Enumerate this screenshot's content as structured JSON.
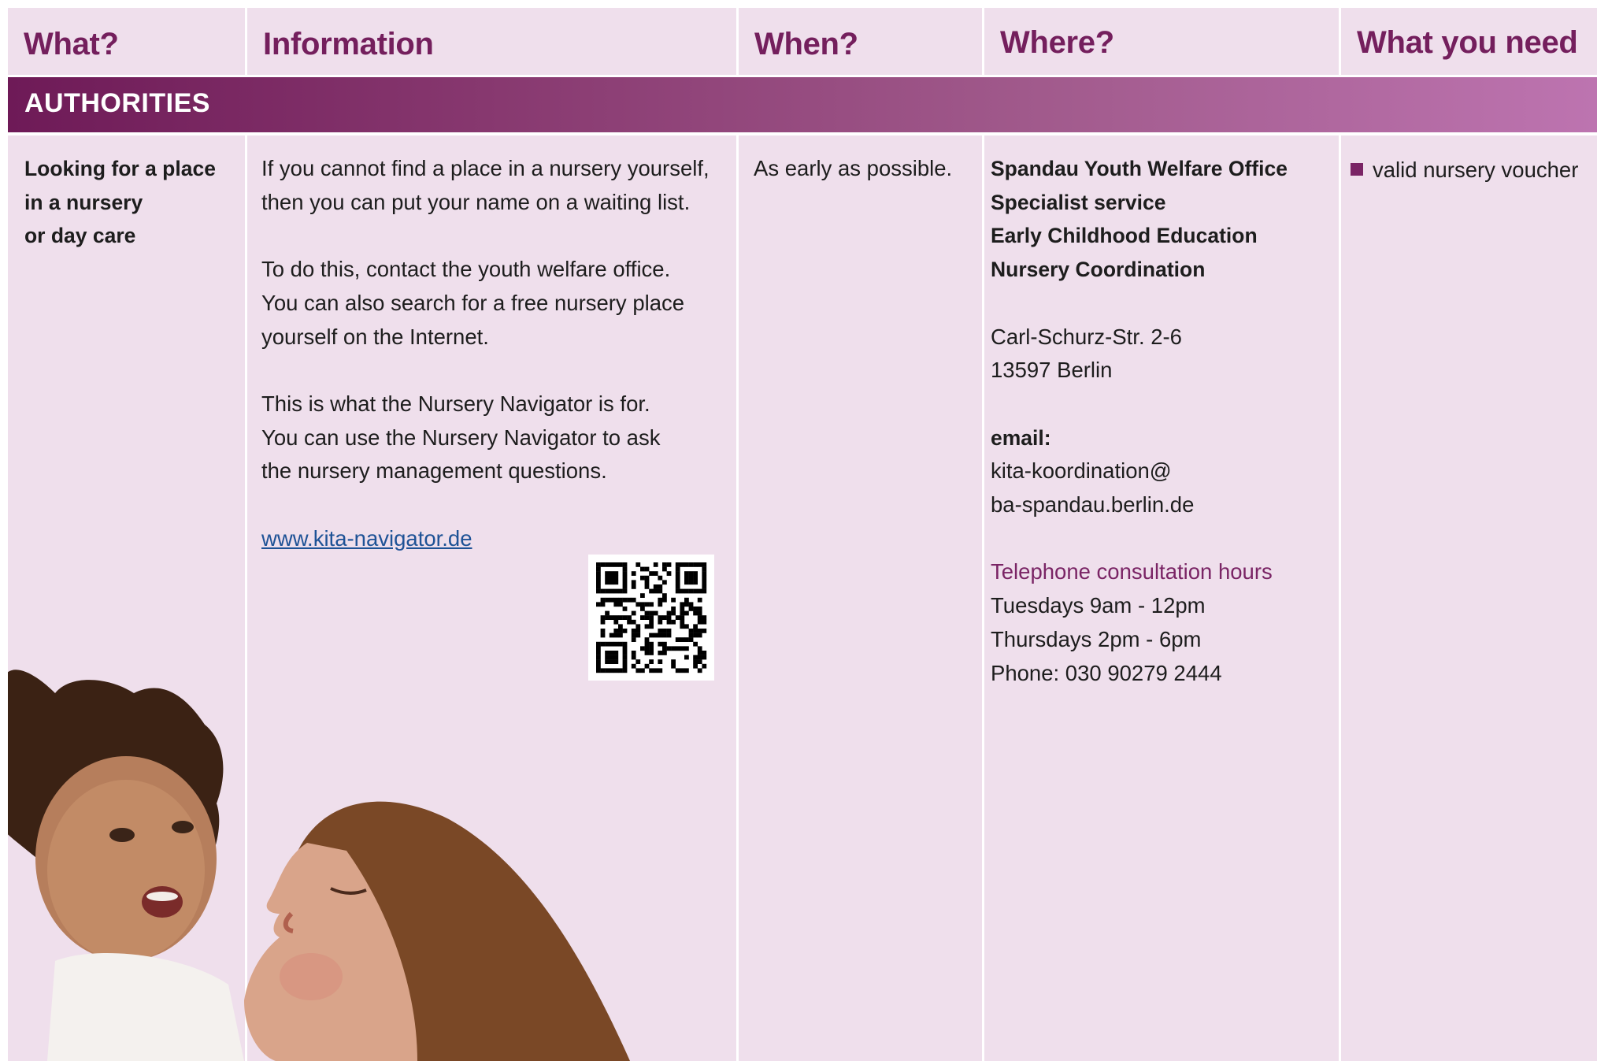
{
  "headers": {
    "what": "What?",
    "information": "Information",
    "when": "When?",
    "where": "Where?",
    "need": "What you need"
  },
  "section": "AUTHORITIES",
  "row": {
    "what": [
      "Looking for a place",
      "in a nursery",
      "or day care"
    ],
    "info_p1": [
      "If you cannot find a place in a nursery yourself,",
      "then you can put your name on a waiting list."
    ],
    "info_p2": [
      "To do this, contact the youth welfare office.",
      "You can also search for a free nursery place",
      "yourself on the Internet."
    ],
    "info_p3": [
      "This is what the Nursery Navigator is for.",
      "You can use the Nursery Navigator to ask",
      "the nursery management questions."
    ],
    "link": "www.kita-navigator.de",
    "when": "As early as possible.",
    "where_heading": [
      "Spandau Youth Welfare Office",
      "Specialist service",
      "Early Childhood Education",
      "Nursery Coordination"
    ],
    "address": [
      "Carl-Schurz-Str. 2-6",
      "13597 Berlin"
    ],
    "email_label": "email:",
    "email": [
      "kita-koordination@",
      "ba-spandau.berlin.de"
    ],
    "hours_label": "Telephone consultation hours",
    "hours": [
      "Tuesdays 9am - 12pm",
      "Thursdays 2pm - 6pm",
      "Phone: 030 90279 2444"
    ],
    "need": "valid nursery voucher"
  },
  "colors": {
    "heading": "#741f5d",
    "cell_bg": "#efdfec",
    "band_start": "#6e1a57",
    "band_end": "#bd74b0",
    "link": "#1e5296"
  },
  "icons": {
    "qr": "qr-code-icon",
    "bullet": "square-bullet-icon"
  }
}
